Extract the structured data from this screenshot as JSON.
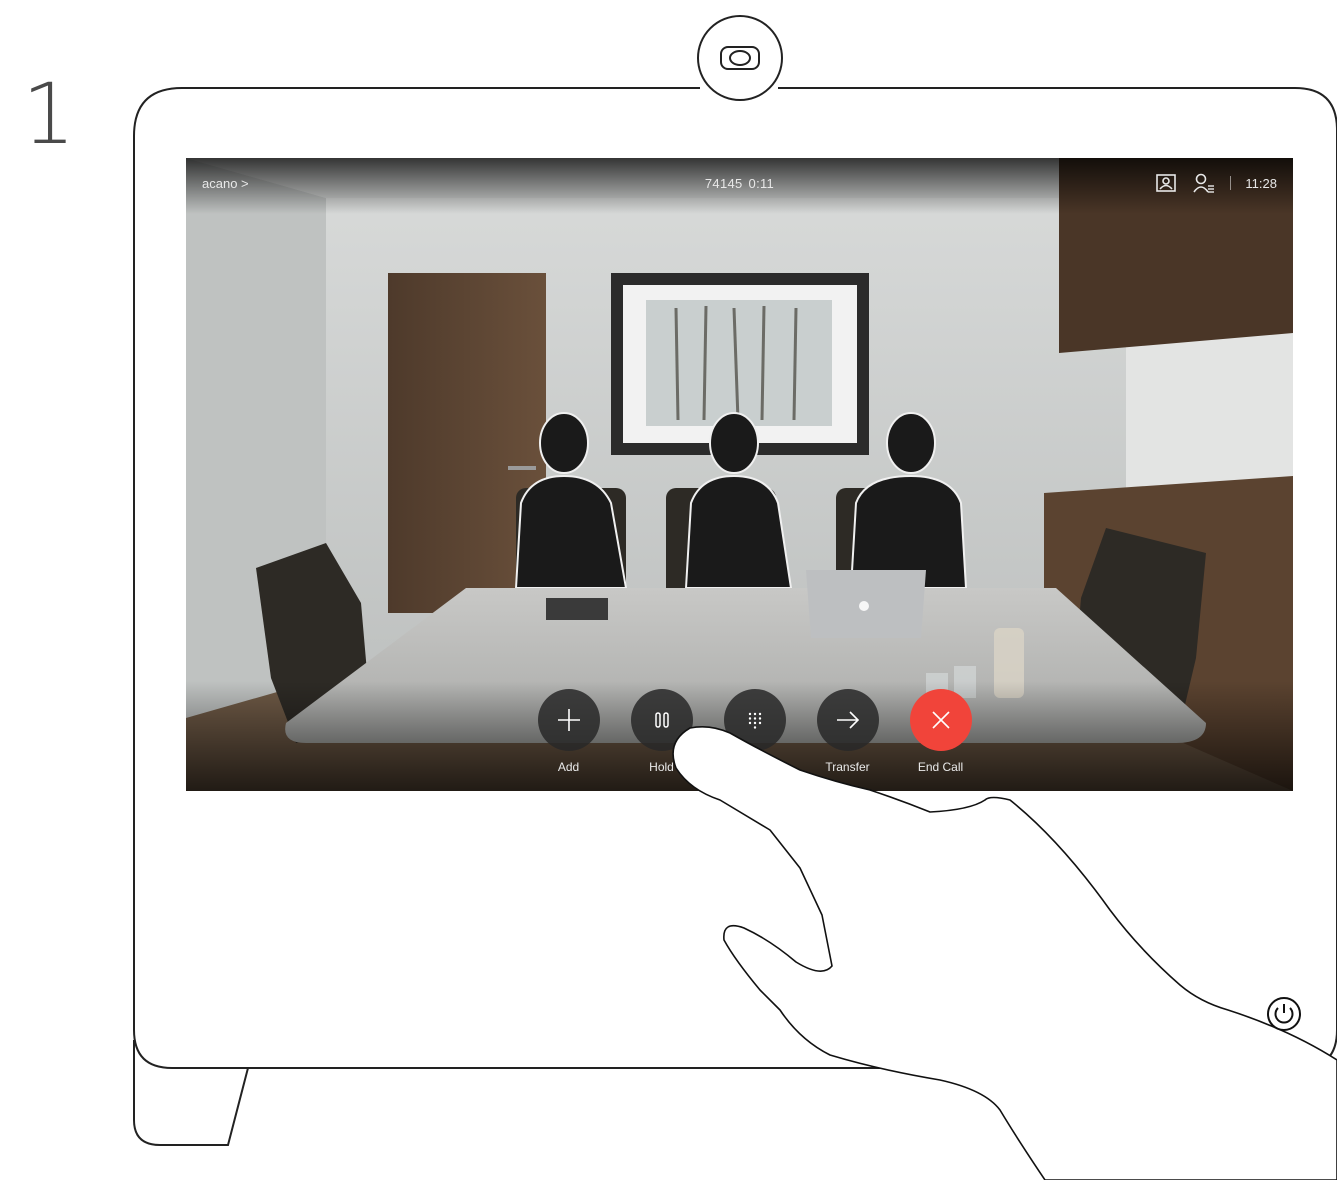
{
  "step": "1",
  "call": {
    "name": "acano",
    "name_chevron": ">",
    "number": "74145",
    "duration": "0:11",
    "time": "11:28"
  },
  "icons": {
    "camera": "camera-icon",
    "self_view": "self-view-icon",
    "participants": "participants-icon",
    "power": "power-icon"
  },
  "controls": [
    {
      "name": "add",
      "label": "Add",
      "icon": "plus-icon"
    },
    {
      "name": "hold",
      "label": "Hold",
      "icon": "pause-icon"
    },
    {
      "name": "keypad",
      "label": "",
      "icon": "keypad-icon"
    },
    {
      "name": "transfer",
      "label": "Transfer",
      "icon": "arrow-right-icon"
    },
    {
      "name": "end-call",
      "label": "End Call",
      "icon": "close-icon"
    }
  ],
  "colors": {
    "end_call": "#f1443a",
    "control_bg": "#282828"
  }
}
